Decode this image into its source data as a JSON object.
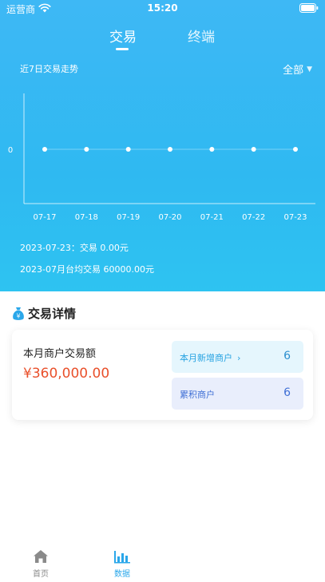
{
  "status_bar": {
    "carrier": "运营商",
    "time": "15:20"
  },
  "tabs": [
    {
      "label": "交易",
      "active": true
    },
    {
      "label": "终端",
      "active": false
    }
  ],
  "chart_header": {
    "title": "近7日交易走势",
    "filter_label": "全部"
  },
  "chart_data": {
    "type": "line",
    "x": [
      "07-17",
      "07-18",
      "07-19",
      "07-20",
      "07-21",
      "07-22",
      "07-23"
    ],
    "series": [
      {
        "values": [
          0,
          0,
          0,
          0,
          0,
          0,
          0
        ]
      }
    ],
    "y_ticks": [
      "0"
    ],
    "grid": false
  },
  "summary": {
    "line1": "2023-07-23：交易 0.00元",
    "line2": "2023-07月台均交易 60000.00元"
  },
  "detail": {
    "section_title": "交易详情",
    "monthly_label": "本月商户交易额",
    "monthly_amount": "¥360,000.00",
    "new_merchants": {
      "label": "本月新增商户",
      "arrow": "›",
      "value": "6"
    },
    "total_merchants": {
      "label": "累积商户",
      "value": "6"
    }
  },
  "tabbar": [
    {
      "label": "首页",
      "icon": "home-icon",
      "active": false
    },
    {
      "label": "数据",
      "icon": "bar-chart-icon",
      "active": true
    }
  ],
  "colors": {
    "accent": "#2aa7ea",
    "header_blue": "#3eb8f5",
    "amount_red": "#e9502b"
  }
}
